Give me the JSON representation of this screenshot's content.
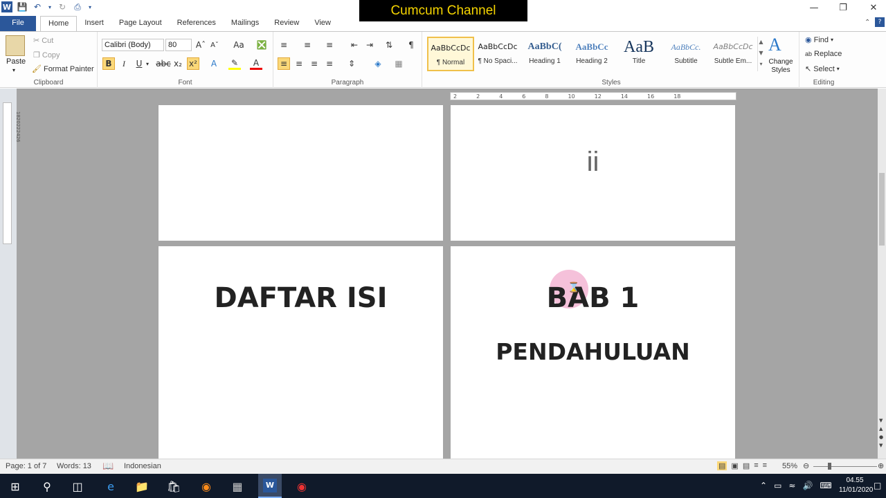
{
  "titlebar": {
    "banner": "Cumcum Channel",
    "minimize": "—",
    "restore": "❐",
    "close": "✕"
  },
  "tabs": [
    "File",
    "Home",
    "Insert",
    "Page Layout",
    "References",
    "Mailings",
    "Review",
    "View"
  ],
  "clipboard": {
    "paste": "Paste",
    "cut": "Cut",
    "copy": "Copy",
    "format_painter": "Format Painter",
    "label": "Clipboard"
  },
  "font": {
    "name": "Calibri (Body)",
    "size": "80",
    "label": "Font"
  },
  "paragraph": {
    "label": "Paragraph"
  },
  "styles": {
    "items": [
      {
        "preview": "AaBbCcDc",
        "name": "¶ Normal"
      },
      {
        "preview": "AaBbCcDc",
        "name": "¶ No Spaci..."
      },
      {
        "preview": "AaBbC(",
        "name": "Heading 1"
      },
      {
        "preview": "AaBbCc",
        "name": "Heading 2"
      },
      {
        "preview": "AaB",
        "name": "Title"
      },
      {
        "preview": "AaBbCc.",
        "name": "Subtitle"
      },
      {
        "preview": "AaBbCcDc",
        "name": "Subtle Em..."
      }
    ],
    "change": "Change Styles",
    "label": "Styles"
  },
  "editing": {
    "find": "Find",
    "replace": "Replace",
    "select": "Select",
    "label": "Editing"
  },
  "ruler_ticks": [
    "2",
    "2",
    "4",
    "6",
    "8",
    "10",
    "12",
    "14",
    "16",
    "18"
  ],
  "vruler_ticks": [
    "18",
    "20",
    "22",
    "24",
    "26"
  ],
  "pages": {
    "roman": "ii",
    "toc": "DAFTAR ISI",
    "chapter": "BAB 1",
    "chapter_title": "PENDAHULUAN"
  },
  "status": {
    "page": "Page: 1 of 7",
    "words": "Words: 13",
    "language": "Indonesian",
    "zoom": "55%"
  },
  "taskbar": {
    "time": "04.55",
    "date": "11/01/2020"
  },
  "colors": {
    "accent": "#2b579a",
    "banner_text": "#f5d400",
    "cursor_highlight": "#f3b6d3"
  }
}
